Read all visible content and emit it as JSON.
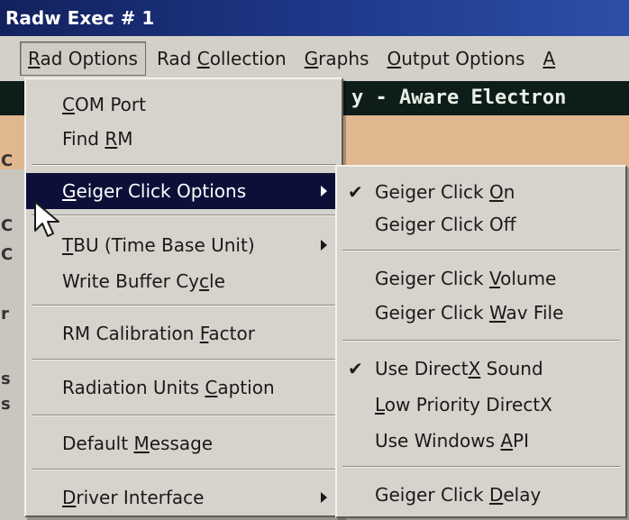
{
  "window": {
    "title": "Radw Exec # 1"
  },
  "menubar": {
    "items": [
      {
        "pre": "",
        "ul": "R",
        "post": "ad Options"
      },
      {
        "pre": "Rad ",
        "ul": "C",
        "post": "ollection"
      },
      {
        "pre": "",
        "ul": "G",
        "post": "raphs"
      },
      {
        "pre": "",
        "ul": "O",
        "post": "utput Options"
      },
      {
        "pre": "",
        "ul": "A",
        "post": ""
      }
    ]
  },
  "content": {
    "banner_text": "y - Aware Electron",
    "edge_letters": [
      "C",
      "C",
      "C",
      "r",
      "s",
      "s"
    ]
  },
  "dropdown": {
    "items": [
      {
        "pre": "",
        "ul": "C",
        "post": "OM Port"
      },
      {
        "pre": "Find ",
        "ul": "R",
        "post": "M"
      },
      {
        "pre": "",
        "ul": "G",
        "post": "eiger Click Options"
      },
      {
        "pre": "",
        "ul": "T",
        "post": "BU (Time Base Unit)"
      },
      {
        "pre": "Write Buffer Cy",
        "ul": "c",
        "post": "le"
      },
      {
        "pre": "RM Calibration ",
        "ul": "F",
        "post": "actor"
      },
      {
        "pre": "Radiation Units ",
        "ul": "C",
        "post": "aption"
      },
      {
        "pre": "Default ",
        "ul": "M",
        "post": "essage"
      },
      {
        "pre": "",
        "ul": "D",
        "post": "river Interface"
      }
    ]
  },
  "submenu": {
    "check_glyph": "✔",
    "items": [
      {
        "pre": "Geiger Click ",
        "ul": "O",
        "post": "n",
        "checked": true
      },
      {
        "pre": "Geiger Click Of",
        "ul": "f",
        "post": "",
        "checked": false
      },
      {
        "pre": "Geiger Click ",
        "ul": "V",
        "post": "olume",
        "checked": false
      },
      {
        "pre": "Geiger Click ",
        "ul": "W",
        "post": "av File",
        "checked": false
      },
      {
        "pre": "Use Direct",
        "ul": "X",
        "post": " Sound",
        "checked": true
      },
      {
        "pre": "",
        "ul": "L",
        "post": "ow Priority DirectX",
        "checked": false
      },
      {
        "pre": "Use Windows ",
        "ul": "A",
        "post": "PI",
        "checked": false
      },
      {
        "pre": "Geiger Click ",
        "ul": "D",
        "post": "elay",
        "checked": false
      }
    ]
  },
  "colors": {
    "titlebar": "#1f3a8c",
    "highlight": "#0c1038",
    "menu_bg": "#d6d3cc",
    "banner_bg": "#0d1d1a",
    "peach": "#e1b78f"
  }
}
